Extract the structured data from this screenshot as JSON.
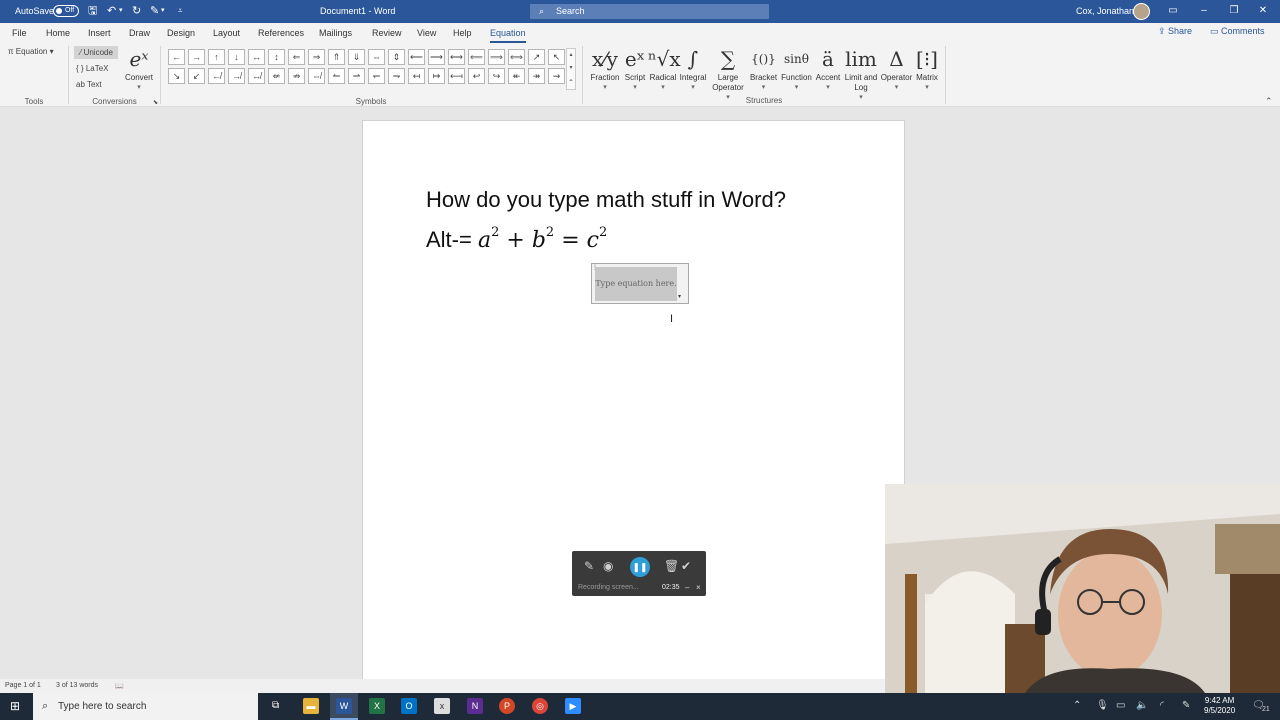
{
  "titlebar": {
    "autosave_label": "AutoSave",
    "autosave_state": "Off",
    "doc_title": "Document1 - Word",
    "search_placeholder": "Search",
    "user_name": "Cox, Jonathan"
  },
  "menu": {
    "tabs": [
      "File",
      "Home",
      "Insert",
      "Draw",
      "Design",
      "Layout",
      "References",
      "Mailings",
      "Review",
      "View",
      "Help",
      "Equation"
    ],
    "active": "Equation",
    "share": "Share",
    "comments": "Comments"
  },
  "ribbon": {
    "tools": {
      "equation_label": "Equation",
      "group_label": "Tools"
    },
    "conversions": {
      "unicode": "Unicode",
      "latex": "LaTeX",
      "text": "Text",
      "convert": "Convert",
      "group_label": "Conversions"
    },
    "symbols": {
      "group_label": "Symbols",
      "row1": [
        "←",
        "→",
        "↑",
        "↓",
        "↔",
        "↕",
        "⇐",
        "⇒",
        "⇑",
        "⇓",
        "⇔",
        "⇕",
        "⟵",
        "⟶",
        "⟷",
        "⟸",
        "⟹",
        "⟺",
        "↗",
        "↖"
      ],
      "row2": [
        "↘",
        "↙",
        "↚",
        "↛",
        "↮",
        "⇍",
        "⇏",
        "⇎",
        "↼",
        "⇀",
        "↽",
        "⇁",
        "↤",
        "↦",
        "⟻",
        "↩",
        "↪",
        "↞",
        "↠",
        "⇝"
      ]
    },
    "structures": {
      "group_label": "Structures",
      "items": [
        {
          "glyph": "x⁄y",
          "label": "Fraction"
        },
        {
          "glyph": "eˣ",
          "label": "Script"
        },
        {
          "glyph": "ⁿ√x",
          "label": "Radical"
        },
        {
          "glyph": "∫",
          "label": "Integral"
        },
        {
          "glyph": "∑",
          "label": "Large Operator"
        },
        {
          "glyph": "{()}",
          "label": "Bracket"
        },
        {
          "glyph": "sinθ",
          "label": "Function"
        },
        {
          "glyph": "ä",
          "label": "Accent"
        },
        {
          "glyph": "lim",
          "label": "Limit and Log"
        },
        {
          "glyph": "Δ",
          "label": "Operator"
        },
        {
          "glyph": "[⁝]",
          "label": "Matrix"
        }
      ]
    }
  },
  "document": {
    "heading": "How do you type math stuff in Word?",
    "eq_prefix": "Alt-=",
    "eq": {
      "a": "a",
      "b": "b",
      "c": "c",
      "exp": "2",
      "plus": "+",
      "equals": "="
    },
    "placeholder": "Type equation here."
  },
  "recorder": {
    "status": "Recording screen...",
    "time": "02:35"
  },
  "statusbar": {
    "page": "Page 1 of 1",
    "words": "3 of 13 words"
  },
  "taskbar": {
    "search": "Type here to search",
    "time": "9:42 AM",
    "date": "9/5/2020",
    "notifications": "21"
  },
  "colors": {
    "word_blue": "#2b579a",
    "recorder_accent": "#2f9ed8"
  }
}
